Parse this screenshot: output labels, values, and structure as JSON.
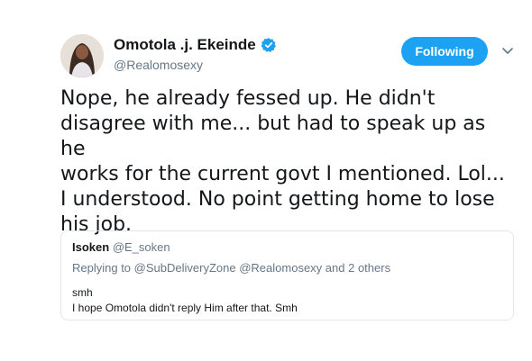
{
  "tweet": {
    "author_name": "Omotola .j. Ekeinde",
    "author_handle": "@Realomosexy",
    "verified": true,
    "follow_button_label": "Following",
    "text": "Nope, he already fessed up. He didn't\ndisagree with me... but had to speak up as he\nworks for the current  govt I mentioned. Lol...\nI understood.  No point getting home to lose\nhis job."
  },
  "quoted_tweet": {
    "author_name": "Isoken",
    "author_handle": "@E_soken",
    "replying_prefix": "Replying to",
    "replying_to": [
      "@SubDeliveryZone",
      "@Realomosexy"
    ],
    "replying_suffix": "and 2 others",
    "text": "smh\nI hope Omotola didn't reply Him after that. Smh"
  },
  "icons": {
    "verified": "verified-badge-icon",
    "caret": "chevron-down-icon"
  },
  "colors": {
    "accent": "#1da1f2",
    "text": "#14171a",
    "secondary": "#657786",
    "border": "#e1e8ed"
  }
}
